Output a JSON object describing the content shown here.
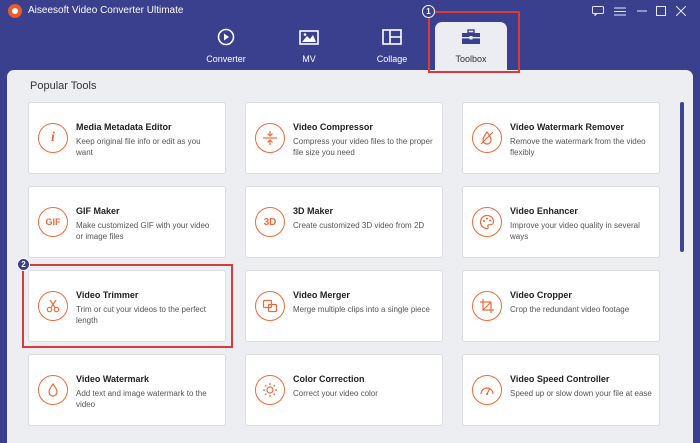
{
  "app": {
    "title": "Aiseesoft Video Converter Ultimate"
  },
  "tabs": [
    {
      "label": "Converter",
      "icon": "converter-icon",
      "active": false
    },
    {
      "label": "MV",
      "icon": "mv-icon",
      "active": false
    },
    {
      "label": "Collage",
      "icon": "collage-icon",
      "active": false
    },
    {
      "label": "Toolbox",
      "icon": "toolbox-icon",
      "active": true
    }
  ],
  "annotations": {
    "badge1": "1",
    "badge2": "2"
  },
  "section": {
    "title": "Popular Tools"
  },
  "tools": [
    {
      "title": "Media Metadata Editor",
      "desc": "Keep original file info or edit as you want",
      "icon": "info-icon",
      "glyph": "i"
    },
    {
      "title": "Video Compressor",
      "desc": "Compress your video files to the proper file size you need",
      "icon": "compress-icon",
      "glyph": ""
    },
    {
      "title": "Video Watermark Remover",
      "desc": "Remove the watermark from the video flexibly",
      "icon": "watermark-remove-icon",
      "glyph": ""
    },
    {
      "title": "GIF Maker",
      "desc": "Make customized GIF with your video or image files",
      "icon": "gif-icon",
      "glyph": "GIF"
    },
    {
      "title": "3D Maker",
      "desc": "Create customized 3D video from 2D",
      "icon": "3d-icon",
      "glyph": "3D"
    },
    {
      "title": "Video Enhancer",
      "desc": "Improve your video quality in several ways",
      "icon": "palette-icon",
      "glyph": ""
    },
    {
      "title": "Video Trimmer",
      "desc": "Trim or cut your videos to the perfect length",
      "icon": "scissors-icon",
      "glyph": ""
    },
    {
      "title": "Video Merger",
      "desc": "Merge multiple clips into a single piece",
      "icon": "merge-icon",
      "glyph": ""
    },
    {
      "title": "Video Cropper",
      "desc": "Crop the redundant video footage",
      "icon": "crop-icon",
      "glyph": ""
    },
    {
      "title": "Video Watermark",
      "desc": "Add text and image watermark to the video",
      "icon": "drop-icon",
      "glyph": ""
    },
    {
      "title": "Color Correction",
      "desc": "Correct your video color",
      "icon": "sun-icon",
      "glyph": ""
    },
    {
      "title": "Video Speed Controller",
      "desc": "Speed up or slow down your file at ease",
      "icon": "speedometer-icon",
      "glyph": ""
    }
  ],
  "colors": {
    "accent": "#ef6a3a",
    "header": "#3a3f8e",
    "highlight": "#d93a3a"
  }
}
